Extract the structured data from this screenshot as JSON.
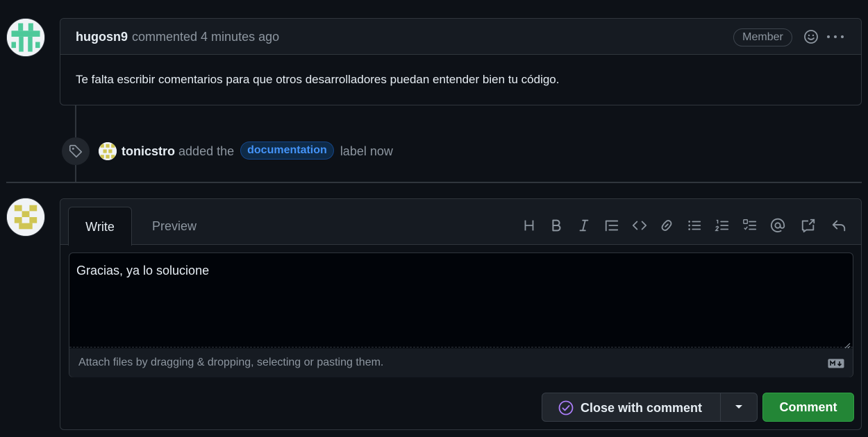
{
  "comment": {
    "author": "hugosn9",
    "meta": "commented 4 minutes ago",
    "badge": "Member",
    "body": "Te falta escribir comentarios para que otros desarrolladores puedan entender bien tu código.",
    "icons": [
      "smiley-icon",
      "kebab-horizontal-icon"
    ]
  },
  "event": {
    "actor": "tonicstro",
    "pre": "added the",
    "label": "documentation",
    "post": "label now",
    "icon": "tag-icon"
  },
  "editor": {
    "tabs": {
      "write": "Write",
      "preview": "Preview"
    },
    "toolbar": [
      "heading-icon",
      "bold-icon",
      "italic-icon",
      "quote-icon",
      "code-icon",
      "link-icon",
      "unordered-list-icon",
      "ordered-list-icon",
      "task-list-icon",
      "mention-icon",
      "cross-reference-icon",
      "reply-icon"
    ],
    "text": "Gracias, ya lo solucione",
    "attach": "Attach files by dragging & dropping, selecting or pasting them.",
    "markdown_icon": "markdown-icon"
  },
  "actions": {
    "close_with_comment": "Close with comment",
    "comment": "Comment"
  },
  "colors": {
    "background": "#0d1117",
    "border": "#30363d",
    "muted": "#8d96a0",
    "label_blue": "#4493f8",
    "primary_green": "#238636",
    "done_purple": "#ab7df8"
  }
}
